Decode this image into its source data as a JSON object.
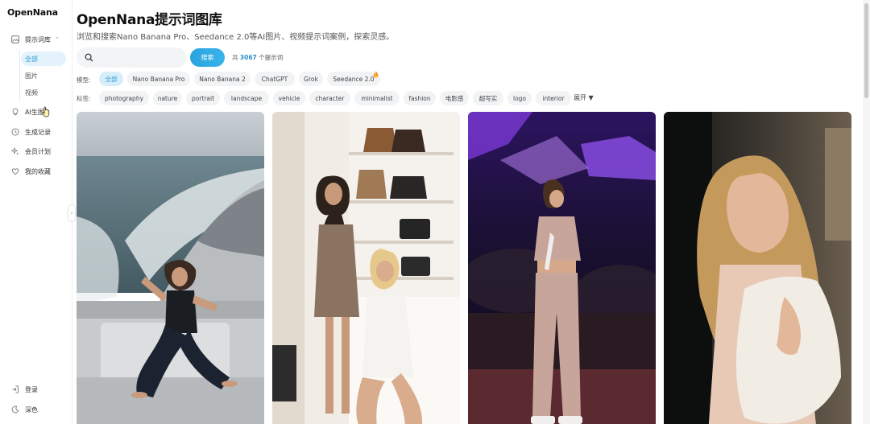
{
  "app": {
    "logo": "OpenNana"
  },
  "sidebar": {
    "main_item": {
      "label": "提示词库",
      "icon": "image-icon"
    },
    "sub_items": [
      {
        "label": "全部",
        "active": true
      },
      {
        "label": "图片",
        "active": false
      },
      {
        "label": "视频",
        "active": false
      }
    ],
    "items": [
      {
        "label": "AI生图",
        "icon": "lightbulb-icon"
      },
      {
        "label": "生成记录",
        "icon": "clock-icon"
      },
      {
        "label": "会员计划",
        "icon": "sparkle-icon"
      },
      {
        "label": "我的收藏",
        "icon": "heart-icon"
      }
    ],
    "bottom_items": [
      {
        "label": "登录",
        "icon": "login-icon"
      },
      {
        "label": "深色",
        "icon": "moon-icon"
      }
    ]
  },
  "header": {
    "title": "OpenNana提示词图库",
    "subtitle": "浏览和搜索Nano Banana Pro、Seedance 2.0等AI图片、视频提示词案例，探索灵感。"
  },
  "search": {
    "placeholder": "",
    "value": "",
    "button_label": "搜索",
    "count_prefix": "共",
    "count_value": "3067",
    "count_suffix": "个提示词"
  },
  "models": {
    "label": "模型:",
    "chips": [
      "全部",
      "Nano Banana Pro",
      "Nano Banana 2",
      "ChatGPT",
      "Grok",
      "Seedance 2.0"
    ],
    "active_index": 0
  },
  "tags": {
    "label": "标签:",
    "chips": [
      "photography",
      "nature",
      "portrait",
      "landscape",
      "vehicle",
      "character",
      "minimalist",
      "fashion",
      "电影感",
      "超写实",
      "logo",
      "interior"
    ],
    "expand_label": "展开 ▼"
  },
  "gallery": {
    "cards": [
      {
        "subject": "woman-on-yacht"
      },
      {
        "subject": "two-women-closet"
      },
      {
        "subject": "singer-on-stage"
      },
      {
        "subject": "woman-portrait-blanket"
      }
    ]
  },
  "colors": {
    "accent": "#2b9ad6",
    "accent_bg": "#d7eefa",
    "chip_bg": "#f1f3f5",
    "search_button": "#39b4ea"
  }
}
